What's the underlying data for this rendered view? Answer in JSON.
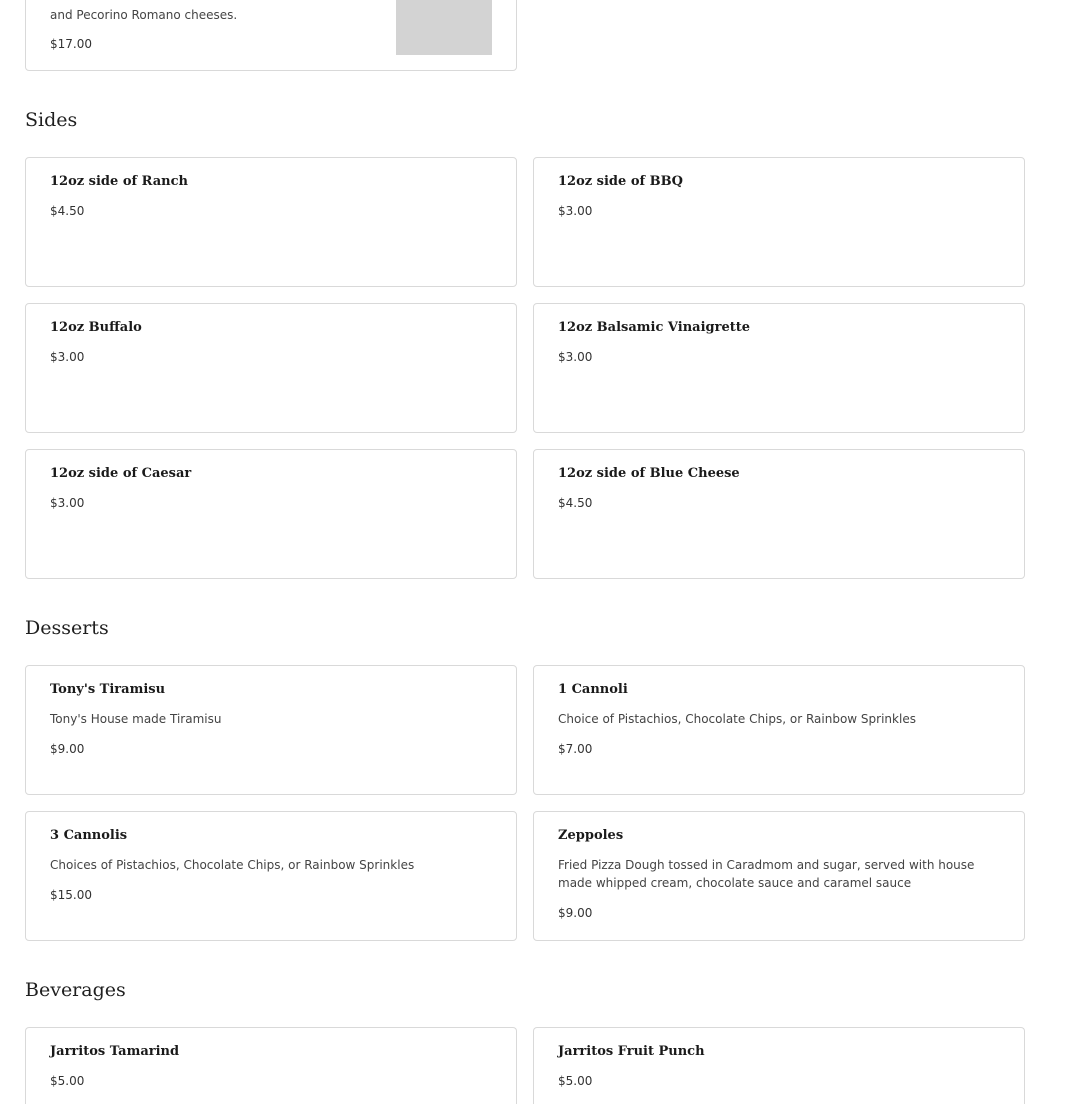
{
  "top_item": {
    "description_tail": "and Pecorino Romano cheeses.",
    "price": "$17.00"
  },
  "sections": {
    "sides": {
      "title": "Sides",
      "items": [
        {
          "name": "12oz side of Ranch",
          "price": "$4.50"
        },
        {
          "name": "12oz side of BBQ",
          "price": "$3.00"
        },
        {
          "name": "12oz Buffalo",
          "price": "$3.00"
        },
        {
          "name": "12oz Balsamic Vinaigrette",
          "price": "$3.00"
        },
        {
          "name": "12oz side of Caesar",
          "price": "$3.00"
        },
        {
          "name": "12oz side of Blue Cheese",
          "price": "$4.50"
        }
      ]
    },
    "desserts": {
      "title": "Desserts",
      "items": [
        {
          "name": "Tony's Tiramisu",
          "description": "Tony's House made Tiramisu",
          "price": "$9.00"
        },
        {
          "name": "1 Cannoli",
          "description": "Choice of Pistachios, Chocolate Chips, or Rainbow Sprinkles",
          "price": "$7.00"
        },
        {
          "name": "3 Cannolis",
          "description": "Choices of Pistachios, Chocolate Chips, or Rainbow Sprinkles",
          "price": "$15.00"
        },
        {
          "name": "Zeppoles",
          "description": "Fried Pizza Dough tossed in Caradmom and sugar, served with house made whipped cream, chocolate sauce and caramel sauce",
          "price": "$9.00"
        }
      ]
    },
    "beverages": {
      "title": "Beverages",
      "items": [
        {
          "name": "Jarritos Tamarind",
          "price": "$5.00"
        },
        {
          "name": "Jarritos Fruit Punch",
          "price": "$5.00"
        }
      ]
    }
  }
}
